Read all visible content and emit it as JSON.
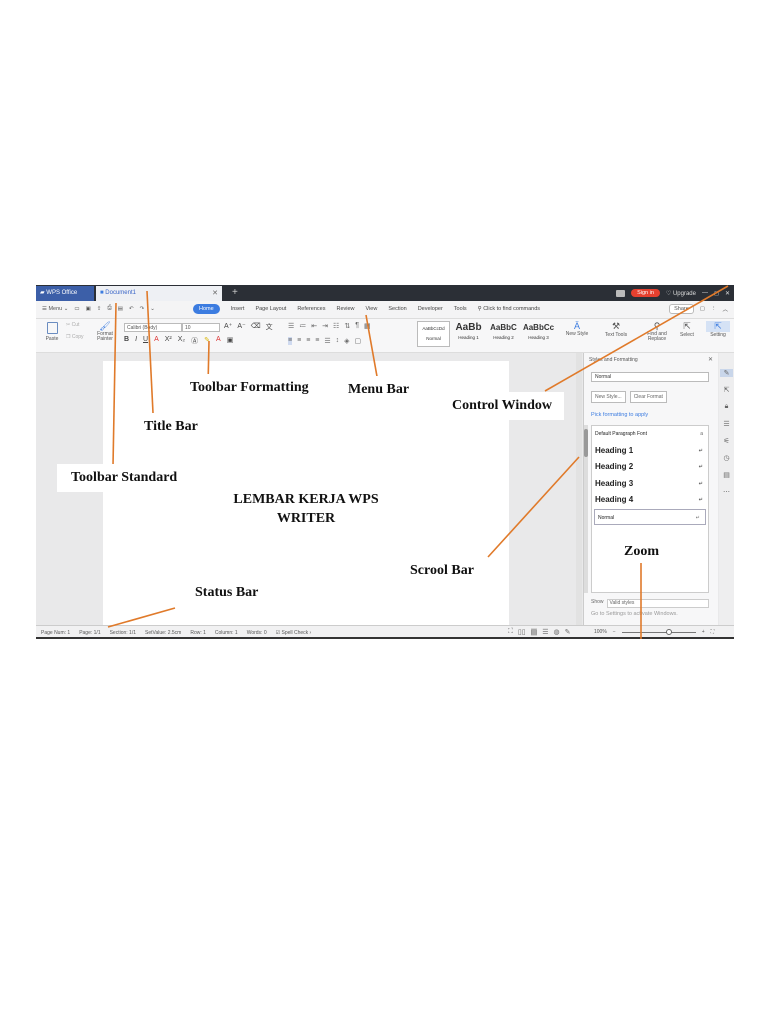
{
  "title_bar": {
    "app_tab": "WPS Office",
    "doc_tab": "Document1",
    "sign_in": "Sign in",
    "upgrade": "Upgrade"
  },
  "menu_bar": {
    "menu": "Menu",
    "tabs": [
      "Home",
      "Insert",
      "Page Layout",
      "References",
      "Review",
      "View",
      "Section",
      "Developer",
      "Tools"
    ],
    "find_commands": "Click to find commands",
    "share": "Share"
  },
  "ribbon": {
    "paste": "Paste",
    "cut": "Cut",
    "copy": "Copy",
    "format_painter": "Format Painter",
    "font_name": "Calibri (Body)",
    "font_size": "10",
    "styles": [
      {
        "sample": "AaBbCcDd",
        "name": "Normal"
      },
      {
        "sample": "AaBb",
        "name": "Heading 1"
      },
      {
        "sample": "AaBbC",
        "name": "Heading 2"
      },
      {
        "sample": "AaBbCc",
        "name": "Heading 3"
      }
    ],
    "new_style": "New Style",
    "text_tools": "Text Tools",
    "find_replace": "Find and Replace",
    "select": "Select",
    "setting": "Setting"
  },
  "task_pane": {
    "title": "Styles and Formatting",
    "current_style": "Normal",
    "new_style_btn": "New Style...",
    "clear_format_btn": "Clear Format",
    "pick_label": "Pick formatting to apply",
    "items": [
      "Default Paragraph Font",
      "Heading 1",
      "Heading 2",
      "Heading 3",
      "Heading 4",
      "Normal"
    ],
    "show_label": "Show",
    "show_value": "Valid styles",
    "activate_text": "Go to Settings to activate Windows."
  },
  "status_bar": {
    "page_num": "Page Num: 1",
    "page": "Page: 1/1",
    "section": "Section: 1/1",
    "setvalue": "SetValue: 2.5cm",
    "row": "Row: 1",
    "column": "Column: 1",
    "words": "Words: 0",
    "spell_check": "Spell Check",
    "zoom": "100%"
  },
  "document": {
    "title_line1": "LEMBAR KERJA WPS",
    "title_line2": "WRITER"
  },
  "callouts": {
    "toolbar_formatting": "Toolbar Formatting",
    "menu_bar": "Menu Bar",
    "control_window": "Control Window",
    "title_bar": "Title Bar",
    "toolbar_standard": "Toolbar Standard",
    "scroll_bar": "Scrool Bar",
    "zoom": "Zoom",
    "status_bar": "Status Bar"
  },
  "colors": {
    "accent": "#3c7ce0",
    "title_bar_bg": "#2b2f36",
    "sign_in": "#e5402f",
    "leader_line": "#e07a2a"
  }
}
